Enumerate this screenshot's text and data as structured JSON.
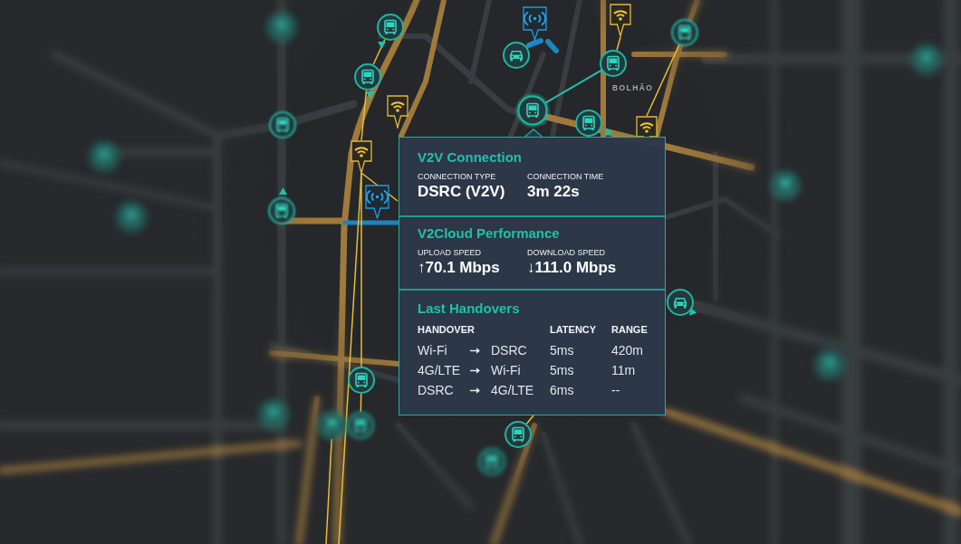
{
  "map": {
    "place_labels": [
      "BOLHÃO"
    ],
    "markers": [
      {
        "kind": "bus",
        "selected": false
      },
      {
        "kind": "wifi",
        "selected": false
      },
      {
        "kind": "beacon",
        "selected": false
      },
      {
        "kind": "bus",
        "selected": false
      },
      {
        "kind": "car",
        "selected": false
      },
      {
        "kind": "bus",
        "selected": false
      },
      {
        "kind": "bus",
        "selected": false
      },
      {
        "kind": "wifi",
        "selected": false
      },
      {
        "kind": "bus",
        "selected": true
      },
      {
        "kind": "bus",
        "selected": false
      },
      {
        "kind": "wifi",
        "selected": false
      },
      {
        "kind": "wifi",
        "selected": false
      },
      {
        "kind": "beacon",
        "selected": false
      },
      {
        "kind": "car",
        "selected": false
      },
      {
        "kind": "bus",
        "selected": false
      },
      {
        "kind": "bus",
        "selected": false
      },
      {
        "kind": "bus",
        "selected": false
      },
      {
        "kind": "bus",
        "selected": false
      },
      {
        "kind": "bus",
        "selected": false
      },
      {
        "kind": "bus",
        "selected": false
      },
      {
        "kind": "bus",
        "selected": false
      },
      {
        "kind": "bus",
        "selected": false
      },
      {
        "kind": "bus",
        "selected": false
      },
      {
        "kind": "bus",
        "selected": false
      },
      {
        "kind": "bus",
        "selected": false
      },
      {
        "kind": "bus",
        "selected": false
      },
      {
        "kind": "bus",
        "selected": false
      },
      {
        "kind": "bus",
        "selected": false
      }
    ]
  },
  "popup": {
    "sections": [
      {
        "kind": "stats",
        "title": "V2V Connection",
        "stats": [
          {
            "label": "CONNECTION TYPE",
            "value": "DSRC (V2V)"
          },
          {
            "label": "CONNECTION TIME",
            "value": "3m 22s"
          }
        ]
      },
      {
        "kind": "stats",
        "title": "V2Cloud Performance",
        "stats": [
          {
            "label": "UPLOAD SPEED",
            "value": "↑70.1 Mbps"
          },
          {
            "label": "DOWNLOAD SPEED",
            "value": "↓111.0 Mbps"
          }
        ]
      },
      {
        "kind": "table",
        "title": "Last Handovers",
        "columns": [
          "HANDOVER",
          "LATENCY",
          "RANGE"
        ],
        "rows": [
          {
            "from": "Wi-Fi",
            "to": "DSRC",
            "latency": "5ms",
            "range": "420m"
          },
          {
            "from": "4G/LTE",
            "to": "Wi-Fi",
            "latency": "5ms",
            "range": "11m"
          },
          {
            "from": "DSRC",
            "to": "4G/LTE",
            "latency": "6ms",
            "range": "--"
          }
        ]
      }
    ]
  }
}
